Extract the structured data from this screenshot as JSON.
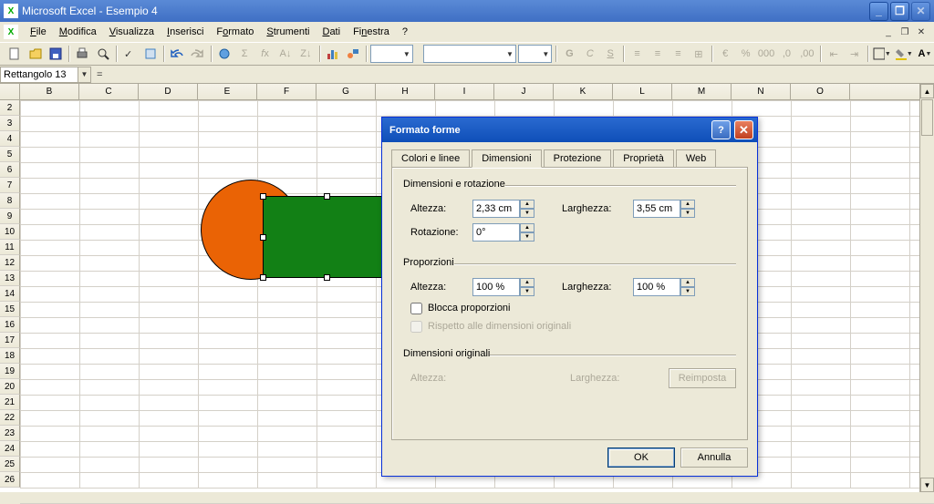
{
  "title": "Microsoft Excel - Esempio 4",
  "menu": [
    "File",
    "Modifica",
    "Visualizza",
    "Inserisci",
    "Formato",
    "Strumenti",
    "Dati",
    "Finestra",
    "?"
  ],
  "menu_ul": [
    "F",
    "M",
    "V",
    "I",
    "o",
    "S",
    "D",
    "n",
    ""
  ],
  "namebox": "Rettangolo 13",
  "cols": [
    "B",
    "C",
    "D",
    "E",
    "F",
    "G",
    "H",
    "I",
    "J",
    "K",
    "L",
    "M",
    "N",
    "O"
  ],
  "rowstart": 2,
  "rowend": 26,
  "dialog": {
    "title": "Formato forme",
    "tabs": [
      "Colori e linee",
      "Dimensioni",
      "Protezione",
      "Proprietà",
      "Web"
    ],
    "active_tab": 1,
    "fs1": "Dimensioni e rotazione",
    "fs2": "Proporzioni",
    "fs3": "Dimensioni originali",
    "l_altezza": "Altezza:",
    "l_larghezza": "Larghezza:",
    "l_rotazione": "Rotazione:",
    "v_altezza": "2,33 cm",
    "v_larghezza": "3,55 cm",
    "v_rotazione": "0°",
    "v_p_altezza": "100 %",
    "v_p_larghezza": "100 %",
    "ckb_lock": "Blocca proporzioni",
    "ckb_orig": "Rispetto alle dimensioni originali",
    "btn_reset": "Reimposta",
    "btn_ok": "OK",
    "btn_cancel": "Annulla"
  }
}
